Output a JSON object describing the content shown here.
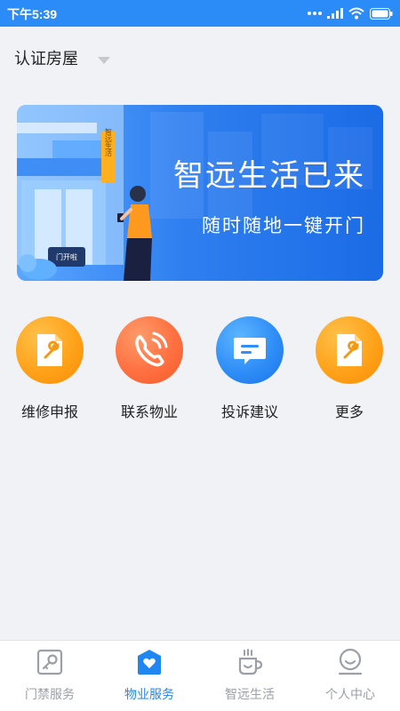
{
  "status_bar": {
    "time": "下午5:39"
  },
  "header": {
    "house_label": "认证房屋"
  },
  "banner": {
    "title": "智远生活已来",
    "subtitle": "随时随地一键开门",
    "sign_text": "智远生活",
    "door_text": "门开啦"
  },
  "services": [
    {
      "label": "维修申报",
      "icon": "wrench-document-icon",
      "color": "#ffa21a"
    },
    {
      "label": "联系物业",
      "icon": "phone-icon",
      "color": "#ff7040"
    },
    {
      "label": "投诉建议",
      "icon": "message-icon",
      "color": "#2f8ef7"
    },
    {
      "label": "更多",
      "icon": "wrench-document-icon",
      "color": "#ffa21a"
    }
  ],
  "tabs": [
    {
      "label": "门禁服务",
      "icon": "key-icon",
      "active": false
    },
    {
      "label": "物业服务",
      "icon": "heart-house-icon",
      "active": true
    },
    {
      "label": "智远生活",
      "icon": "coffee-cup-icon",
      "active": false
    },
    {
      "label": "个人中心",
      "icon": "user-icon",
      "active": false
    }
  ],
  "colors": {
    "primary": "#2b8cf7",
    "tab_active": "#1f86f2",
    "tab_inactive": "#9aa0a6",
    "background": "#f0f2f5"
  }
}
